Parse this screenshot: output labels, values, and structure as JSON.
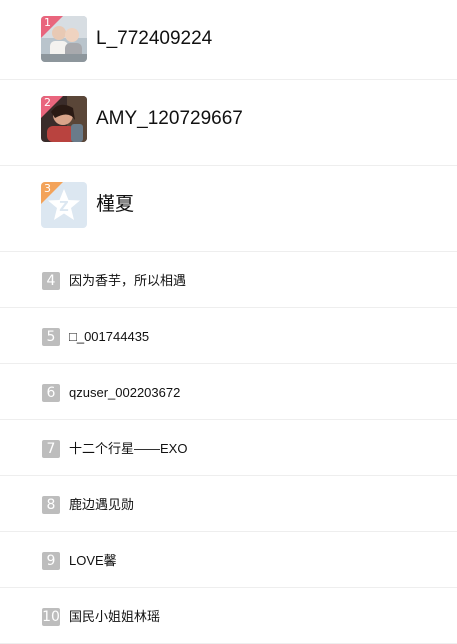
{
  "ranking": {
    "top": [
      {
        "rank": "1",
        "name": "L_772409224",
        "avatar_icon": "photo-avatar-couple",
        "badge_color": "#e9657d"
      },
      {
        "rank": "2",
        "name": "AMY_120729667",
        "avatar_icon": "photo-avatar-person",
        "badge_color": "#e9657d"
      },
      {
        "rank": "3",
        "name": "槿夏",
        "avatar_icon": "qzone-star-default-avatar",
        "badge_color": "#f3a35a"
      }
    ],
    "rest": [
      {
        "rank": "4",
        "name": "因为香芋，所以相遇"
      },
      {
        "rank": "5",
        "name": "□_001744435"
      },
      {
        "rank": "6",
        "name": "qzuser_002203672"
      },
      {
        "rank": "7",
        "name": "十二个行星——EXO"
      },
      {
        "rank": "8",
        "name": "鹿边遇见勋"
      },
      {
        "rank": "9",
        "name": "LOVE馨"
      },
      {
        "rank": "10",
        "name": "国民小姐姐林瑶"
      }
    ]
  },
  "colors": {
    "rank_badge_gray": "#bdbdbd",
    "divider": "#eeeeee"
  }
}
